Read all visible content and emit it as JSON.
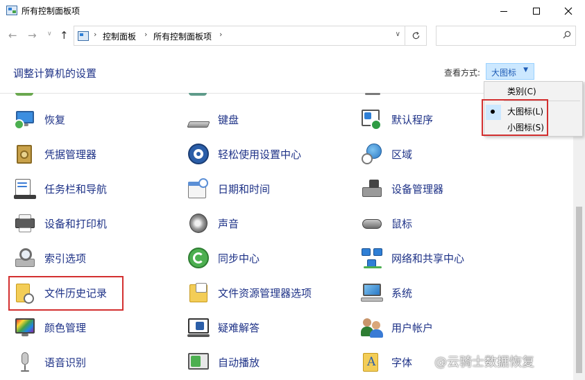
{
  "window": {
    "title": "所有控制面板项"
  },
  "nav": {
    "breadcrumbs": [
      "控制面板",
      "所有控制面板项"
    ],
    "search_placeholder": ""
  },
  "header": {
    "title": "调整计算机的设置",
    "view_by_label": "查看方式:",
    "view_by_value": "大图标"
  },
  "view_menu": {
    "items": [
      "类别(C)",
      "大图标(L)",
      "小图标(S)"
    ],
    "selected": "大图标(L)"
  },
  "items": [
    {
      "label": "恢复",
      "icon": "recovery-icon"
    },
    {
      "label": "键盘",
      "icon": "keyboard-icon"
    },
    {
      "label": "默认程序",
      "icon": "default-programs-icon"
    },
    {
      "label": "凭据管理器",
      "icon": "credential-manager-icon"
    },
    {
      "label": "轻松使用设置中心",
      "icon": "ease-of-access-icon"
    },
    {
      "label": "区域",
      "icon": "region-icon"
    },
    {
      "label": "任务栏和导航",
      "icon": "taskbar-icon"
    },
    {
      "label": "日期和时间",
      "icon": "date-time-icon"
    },
    {
      "label": "设备管理器",
      "icon": "device-manager-icon"
    },
    {
      "label": "设备和打印机",
      "icon": "devices-printers-icon"
    },
    {
      "label": "声音",
      "icon": "sound-icon"
    },
    {
      "label": "鼠标",
      "icon": "mouse-icon"
    },
    {
      "label": "索引选项",
      "icon": "indexing-options-icon"
    },
    {
      "label": "同步中心",
      "icon": "sync-center-icon"
    },
    {
      "label": "网络和共享中心",
      "icon": "network-sharing-icon"
    },
    {
      "label": "文件历史记录",
      "icon": "file-history-icon"
    },
    {
      "label": "文件资源管理器选项",
      "icon": "file-explorer-options-icon"
    },
    {
      "label": "系统",
      "icon": "system-icon"
    },
    {
      "label": "颜色管理",
      "icon": "color-management-icon"
    },
    {
      "label": "疑难解答",
      "icon": "troubleshooting-icon"
    },
    {
      "label": "用户帐户",
      "icon": "user-accounts-icon"
    },
    {
      "label": "语音识别",
      "icon": "speech-recognition-icon"
    },
    {
      "label": "自动播放",
      "icon": "autoplay-icon"
    },
    {
      "label": "字体",
      "icon": "fonts-icon"
    }
  ],
  "watermark": "@云骑士数据恢复"
}
